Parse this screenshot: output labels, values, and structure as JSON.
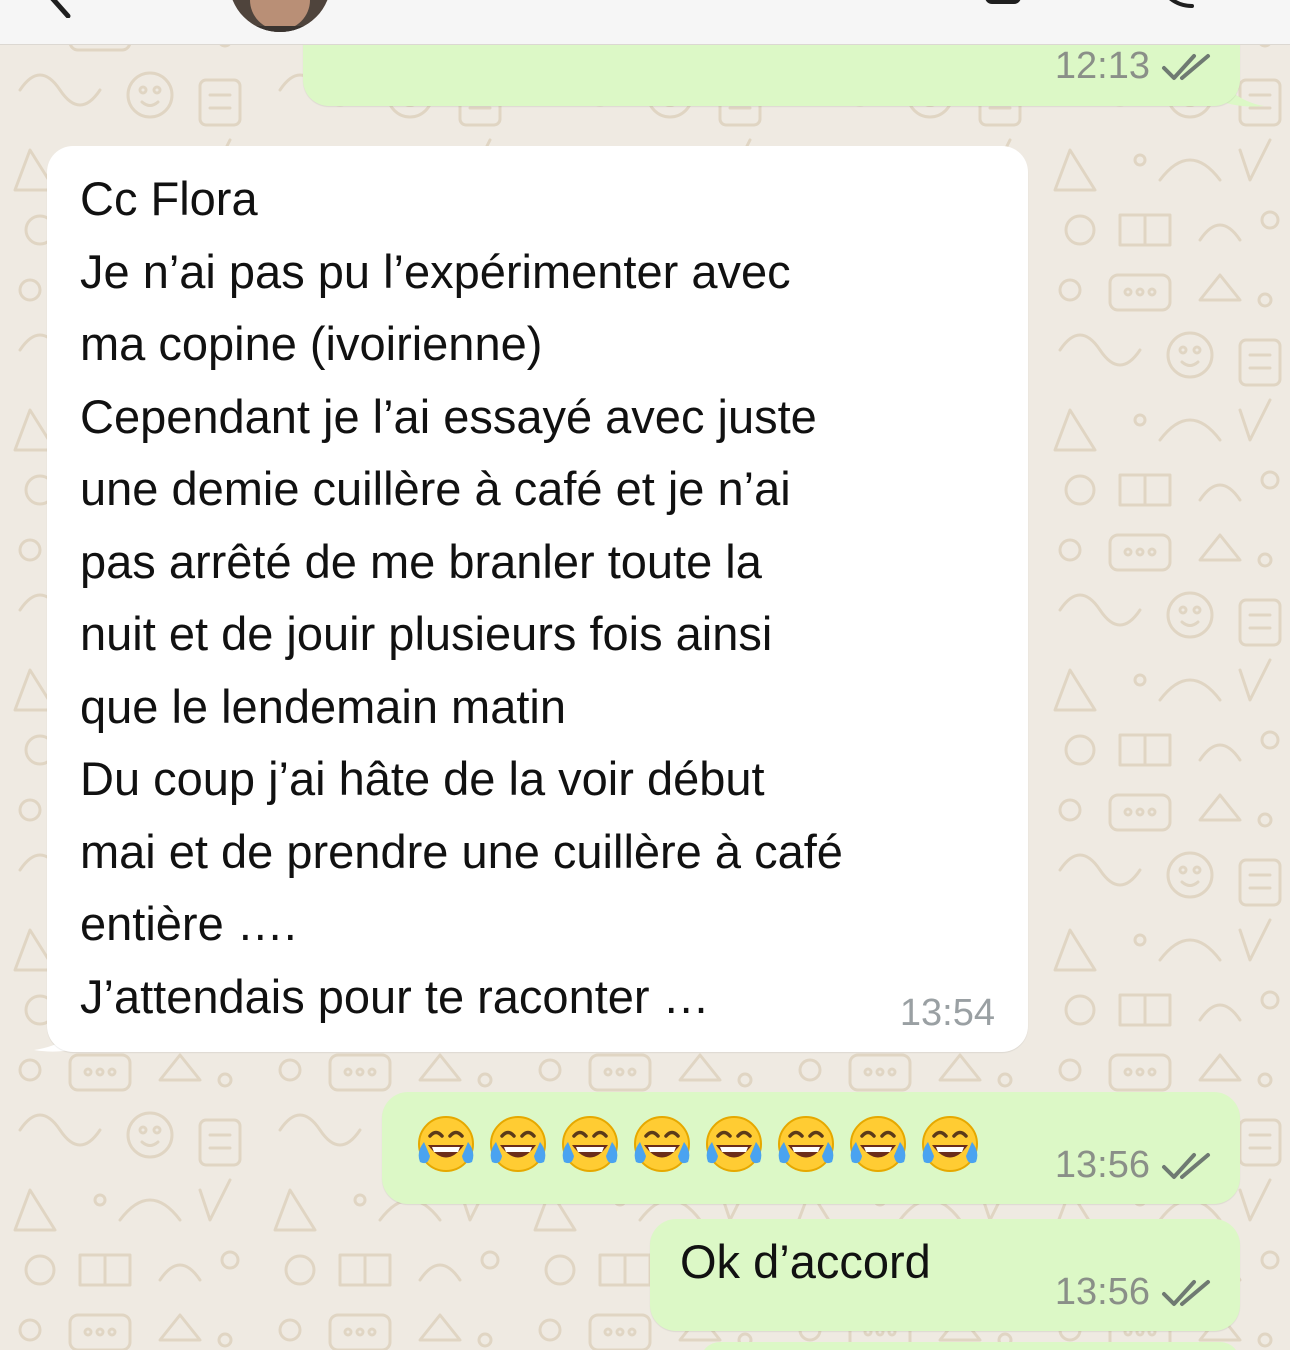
{
  "chat": {
    "messages": [
      {
        "id": "m1",
        "direction": "outgoing",
        "time": "12:13",
        "status": "read"
      },
      {
        "id": "m2",
        "direction": "incoming",
        "lines": [
          "Cc Flora",
          "Je n’ai pas pu l’expérimenter avec",
          "ma copine (ivoirienne)",
          "Cependant je l’ai essayé avec juste",
          "une demie cuillère à café et je n’ai",
          "pas arrêté de me branler toute la",
          "nuit et de jouir plusieurs fois ainsi",
          "que le lendemain matin",
          "Du coup j’ai hâte de la voir début",
          "mai et de prendre une cuillère à café",
          "entière ….",
          "J’attendais pour te raconter …"
        ],
        "time": "13:54"
      },
      {
        "id": "m3",
        "direction": "outgoing",
        "emoji": "face-with-tears-of-joy",
        "emoji_count": 8,
        "time": "13:56",
        "status": "read"
      },
      {
        "id": "m4",
        "direction": "outgoing",
        "text": "Ok d’accord",
        "time": "13:56",
        "status": "read"
      }
    ]
  },
  "icons": [
    "back-chevron-icon",
    "contact-avatar",
    "video-call-icon",
    "phone-call-icon",
    "double-check-icon",
    "face-with-tears-of-joy"
  ],
  "colors": {
    "wallpaper": "#efeae2",
    "outgoing_bubble": "#dcf8c6",
    "incoming_bubble": "#ffffff",
    "timestamp": "#8a8f88",
    "read_ticks": "#6f7a72"
  }
}
